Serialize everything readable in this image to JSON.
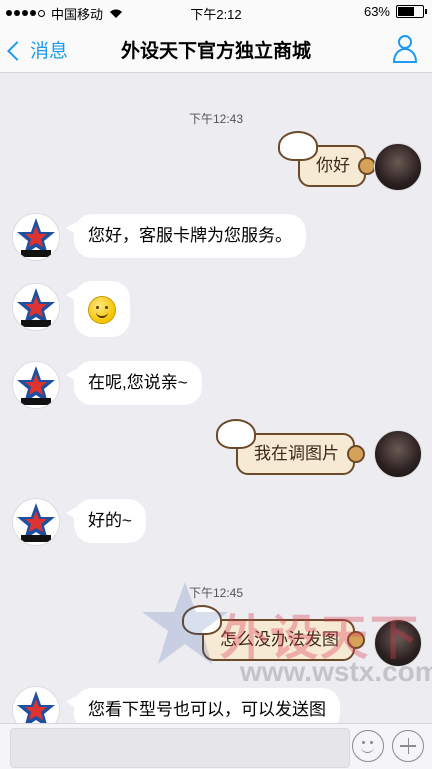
{
  "status_bar": {
    "carrier": "中国移动",
    "time": "下午2:12",
    "battery": "63%",
    "battery_level": 0.63
  },
  "nav": {
    "back_label": "消息",
    "title": "外设天下官方独立商城"
  },
  "messages": {
    "ts1": "下午12:43",
    "m1": "你好",
    "m2": "您好，客服卡牌为您服务。",
    "m3_emoji": "smile-emoji",
    "m4": "在呢,您说亲~",
    "m5": "我在调图片",
    "m6": "好的~",
    "ts2": "下午12:45",
    "m7": "怎么没办法发图",
    "m8": "您看下型号也可以，可以发送图"
  },
  "watermark": {
    "text": "外设天下",
    "url": "www.wstx.com"
  },
  "input": {
    "placeholder": ""
  },
  "colors": {
    "accent": "#1e9bf0",
    "background": "#ececf1",
    "bubble_out": "#f6ead4"
  }
}
